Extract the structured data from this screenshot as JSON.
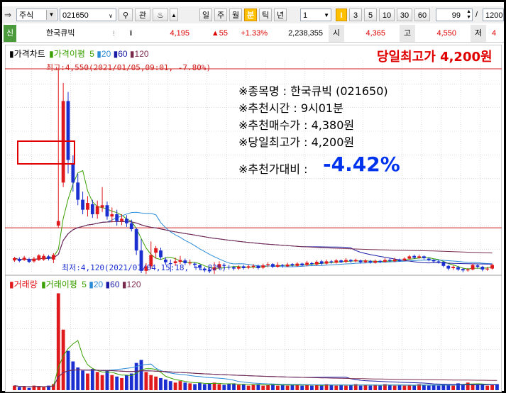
{
  "toolbar": {
    "market": "주식",
    "code": "021650",
    "search_icon": "magnifier-icon",
    "btn_gwan": "관",
    "period_buttons": [
      "일",
      "주",
      "월",
      "분",
      "틱",
      "년"
    ],
    "interval_value": "1",
    "marker_label": "I",
    "minute_buttons": [
      "3",
      "5",
      "10",
      "30",
      "60"
    ],
    "count_value": "99",
    "separator": "/",
    "total_value": "1200"
  },
  "quote": {
    "sin_label": "신",
    "name": "한국큐빅",
    "info_icon": "i",
    "price": "4,195",
    "change": "▲55",
    "change_pct": "+1.33%",
    "volume": "2,238,355",
    "open_label": "시",
    "open": "4,365",
    "high_label": "고",
    "high": "4,550",
    "low_label": "저"
  },
  "legend": {
    "price_chart": "가격차트",
    "ma_label": "가격이평",
    "ma_periods": [
      "5",
      "20",
      "60",
      "120"
    ],
    "volume": "거래량",
    "vol_ma_label": "거래이평",
    "vol_ma_periods": [
      "5",
      "20",
      "60",
      "120"
    ]
  },
  "annotations": {
    "headline": "당일최고가 4,200원",
    "high_note": "최고:4,550(2021/01/05,09:01, -7.80%)",
    "low_note": "최저:4,120(2021/01/04,15:18, +1.82%)",
    "stock_name": "※종목명 : 한국큐빅 (021650)",
    "rec_time": "※추천시간 : 9시01분",
    "rec_price": "※추천매수가 : 4,380원",
    "day_high": "※당일최고가 : 4,200원",
    "vs_label": "※추천가대비 :",
    "vs_value": "-4.42%"
  },
  "colors": {
    "up": "#e0191c",
    "down": "#1b2fd0",
    "ma5": "#3aa000",
    "ma20": "#2c8bd6",
    "ma60": "#1a1aa6",
    "ma120": "#7a2a4c",
    "headline": "#e00000",
    "vs_value": "#0033ee"
  },
  "chart_data": {
    "type": "candlestick",
    "title": "",
    "price_range": [
      4100,
      4570
    ],
    "high_line": 4200,
    "candles": [
      {
        "o": 4128,
        "c": 4133,
        "h": 4136,
        "l": 4125
      },
      {
        "o": 4131,
        "c": 4127,
        "h": 4135,
        "l": 4124
      },
      {
        "o": 4129,
        "c": 4134,
        "h": 4138,
        "l": 4127
      },
      {
        "o": 4131,
        "c": 4125,
        "h": 4134,
        "l": 4122
      },
      {
        "o": 4126,
        "c": 4132,
        "h": 4136,
        "l": 4123
      },
      {
        "o": 4129,
        "c": 4139,
        "h": 4142,
        "l": 4127
      },
      {
        "o": 4130,
        "c": 4138,
        "h": 4142,
        "l": 4127
      },
      {
        "o": 4137,
        "c": 4132,
        "h": 4140,
        "l": 4128
      },
      {
        "o": 4130,
        "c": 4140,
        "h": 4144,
        "l": 4122
      },
      {
        "o": 4205,
        "c": 4215,
        "h": 4550,
        "l": 4200
      },
      {
        "o": 4300,
        "c": 4480,
        "h": 4520,
        "l": 4290
      },
      {
        "o": 4480,
        "c": 4350,
        "h": 4500,
        "l": 4320
      },
      {
        "o": 4340,
        "c": 4300,
        "h": 4360,
        "l": 4280
      },
      {
        "o": 4300,
        "c": 4262,
        "h": 4320,
        "l": 4250
      },
      {
        "o": 4262,
        "c": 4240,
        "h": 4280,
        "l": 4230
      },
      {
        "o": 4240,
        "c": 4255,
        "h": 4270,
        "l": 4225
      },
      {
        "o": 4252,
        "c": 4230,
        "h": 4262,
        "l": 4222
      },
      {
        "o": 4230,
        "c": 4248,
        "h": 4260,
        "l": 4220
      },
      {
        "o": 4245,
        "c": 4250,
        "h": 4290,
        "l": 4235
      },
      {
        "o": 4250,
        "c": 4225,
        "h": 4258,
        "l": 4218
      },
      {
        "o": 4225,
        "c": 4230,
        "h": 4245,
        "l": 4212
      },
      {
        "o": 4230,
        "c": 4215,
        "h": 4240,
        "l": 4205
      },
      {
        "o": 4215,
        "c": 4220,
        "h": 4230,
        "l": 4206
      },
      {
        "o": 4220,
        "c": 4210,
        "h": 4228,
        "l": 4202
      },
      {
        "o": 4210,
        "c": 4197,
        "h": 4218,
        "l": 4192
      },
      {
        "o": 4197,
        "c": 4150,
        "h": 4200,
        "l": 4140
      },
      {
        "o": 4150,
        "c": 4105,
        "h": 4175,
        "l": 4100
      },
      {
        "o": 4105,
        "c": 4115,
        "h": 4122,
        "l": 4098
      },
      {
        "o": 4115,
        "c": 4140,
        "h": 4170,
        "l": 4110
      },
      {
        "o": 4145,
        "c": 4155,
        "h": 4160,
        "l": 4132
      },
      {
        "o": 4150,
        "c": 4135,
        "h": 4156,
        "l": 4130
      },
      {
        "o": 4130,
        "c": 4124,
        "h": 4135,
        "l": 4118
      },
      {
        "o": 4122,
        "c": 4120,
        "h": 4130,
        "l": 4103
      },
      {
        "o": 4122,
        "c": 4126,
        "h": 4134,
        "l": 4116
      },
      {
        "o": 4125,
        "c": 4129,
        "h": 4138,
        "l": 4120
      },
      {
        "o": 4128,
        "c": 4122,
        "h": 4132,
        "l": 4118
      },
      {
        "o": 4122,
        "c": 4123,
        "h": 4130,
        "l": 4117
      },
      {
        "o": 4121,
        "c": 4118,
        "h": 4124,
        "l": 4113
      },
      {
        "o": 4117,
        "c": 4112,
        "h": 4119,
        "l": 4108
      },
      {
        "o": 4110,
        "c": 4106,
        "h": 4114,
        "l": 4102
      },
      {
        "o": 4107,
        "c": 4104,
        "h": 4112,
        "l": 4100
      },
      {
        "o": 4106,
        "c": 4113,
        "h": 4124,
        "l": 4098
      },
      {
        "o": 4112,
        "c": 4120,
        "h": 4126,
        "l": 4108
      },
      {
        "o": 4118,
        "c": 4116,
        "h": 4122,
        "l": 4110
      },
      {
        "o": 4114,
        "c": 4113,
        "h": 4118,
        "l": 4108
      },
      {
        "o": 4113,
        "c": 4110,
        "h": 4116,
        "l": 4106
      },
      {
        "o": 4110,
        "c": 4114,
        "h": 4117,
        "l": 4107
      },
      {
        "o": 4115,
        "c": 4111,
        "h": 4118,
        "l": 4108
      },
      {
        "o": 4112,
        "c": 4115,
        "h": 4119,
        "l": 4109
      },
      {
        "o": 4114,
        "c": 4116,
        "h": 4120,
        "l": 4110
      },
      {
        "o": 4116,
        "c": 4111,
        "h": 4119,
        "l": 4108
      },
      {
        "o": 4112,
        "c": 4117,
        "h": 4121,
        "l": 4109
      },
      {
        "o": 4118,
        "c": 4120,
        "h": 4124,
        "l": 4113
      },
      {
        "o": 4120,
        "c": 4114,
        "h": 4122,
        "l": 4111
      },
      {
        "o": 4114,
        "c": 4118,
        "h": 4124,
        "l": 4112
      },
      {
        "o": 4118,
        "c": 4116,
        "h": 4120,
        "l": 4112
      },
      {
        "o": 4115,
        "c": 4119,
        "h": 4123,
        "l": 4113
      },
      {
        "o": 4120,
        "c": 4117,
        "h": 4122,
        "l": 4114
      },
      {
        "o": 4116,
        "c": 4121,
        "h": 4124,
        "l": 4114
      },
      {
        "o": 4121,
        "c": 4117,
        "h": 4123,
        "l": 4115
      },
      {
        "o": 4118,
        "c": 4123,
        "h": 4127,
        "l": 4115
      },
      {
        "o": 4122,
        "c": 4120,
        "h": 4125,
        "l": 4117
      },
      {
        "o": 4119,
        "c": 4125,
        "h": 4128,
        "l": 4117
      },
      {
        "o": 4126,
        "c": 4121,
        "h": 4129,
        "l": 4118
      },
      {
        "o": 4121,
        "c": 4126,
        "h": 4130,
        "l": 4119
      },
      {
        "o": 4126,
        "c": 4124,
        "h": 4129,
        "l": 4121
      },
      {
        "o": 4123,
        "c": 4128,
        "h": 4131,
        "l": 4121
      },
      {
        "o": 4128,
        "c": 4124,
        "h": 4130,
        "l": 4122
      },
      {
        "o": 4125,
        "c": 4129,
        "h": 4133,
        "l": 4122
      },
      {
        "o": 4129,
        "c": 4126,
        "h": 4131,
        "l": 4123
      },
      {
        "o": 4126,
        "c": 4129,
        "h": 4132,
        "l": 4124
      },
      {
        "o": 4128,
        "c": 4124,
        "h": 4130,
        "l": 4121
      },
      {
        "o": 4124,
        "c": 4128,
        "h": 4131,
        "l": 4122
      },
      {
        "o": 4127,
        "c": 4124,
        "h": 4129,
        "l": 4121
      },
      {
        "o": 4123,
        "c": 4127,
        "h": 4130,
        "l": 4121
      },
      {
        "o": 4127,
        "c": 4125,
        "h": 4129,
        "l": 4122
      },
      {
        "o": 4125,
        "c": 4129,
        "h": 4133,
        "l": 4123
      },
      {
        "o": 4129,
        "c": 4127,
        "h": 4132,
        "l": 4124
      },
      {
        "o": 4126,
        "c": 4130,
        "h": 4134,
        "l": 4124
      },
      {
        "o": 4130,
        "c": 4127,
        "h": 4132,
        "l": 4125
      },
      {
        "o": 4128,
        "c": 4132,
        "h": 4135,
        "l": 4126
      },
      {
        "o": 4132,
        "c": 4137,
        "h": 4140,
        "l": 4130
      },
      {
        "o": 4138,
        "c": 4134,
        "h": 4141,
        "l": 4131
      },
      {
        "o": 4134,
        "c": 4137,
        "h": 4141,
        "l": 4132
      },
      {
        "o": 4137,
        "c": 4133,
        "h": 4139,
        "l": 4130
      },
      {
        "o": 4132,
        "c": 4129,
        "h": 4135,
        "l": 4126
      },
      {
        "o": 4129,
        "c": 4126,
        "h": 4131,
        "l": 4122
      },
      {
        "o": 4126,
        "c": 4125,
        "h": 4129,
        "l": 4121
      },
      {
        "o": 4125,
        "c": 4116,
        "h": 4126,
        "l": 4113
      },
      {
        "o": 4116,
        "c": 4110,
        "h": 4118,
        "l": 4106
      },
      {
        "o": 4111,
        "c": 4114,
        "h": 4117,
        "l": 4107
      },
      {
        "o": 4113,
        "c": 4108,
        "h": 4116,
        "l": 4105
      },
      {
        "o": 4109,
        "c": 4106,
        "h": 4112,
        "l": 4102
      },
      {
        "o": 4106,
        "c": 4108,
        "h": 4111,
        "l": 4103
      },
      {
        "o": 4108,
        "c": 4118,
        "h": 4121,
        "l": 4106
      },
      {
        "o": 4117,
        "c": 4114,
        "h": 4120,
        "l": 4110
      },
      {
        "o": 4114,
        "c": 4108,
        "h": 4116,
        "l": 4104
      },
      {
        "o": 4108,
        "c": 4110,
        "h": 4114,
        "l": 4105
      },
      {
        "o": 4110,
        "c": 4118,
        "h": 4121,
        "l": 4108
      }
    ],
    "volumes": [
      6,
      4,
      5,
      3,
      6,
      5,
      4,
      6,
      8,
      128,
      80,
      52,
      38,
      30,
      26,
      22,
      28,
      24,
      20,
      26,
      20,
      18,
      16,
      20,
      22,
      36,
      40,
      24,
      20,
      18,
      16,
      14,
      12,
      10,
      12,
      10,
      9,
      8,
      10,
      8,
      9,
      10,
      8,
      7,
      8,
      9,
      7,
      8,
      6,
      7,
      8,
      6,
      7,
      8,
      6,
      7,
      6,
      7,
      8,
      6,
      7,
      6,
      7,
      6,
      8,
      7,
      6,
      7,
      6,
      7,
      8,
      6,
      7,
      6,
      7,
      6,
      8,
      7,
      6,
      7,
      6,
      7,
      6,
      8,
      7,
      6,
      7,
      6,
      8,
      7,
      6,
      9,
      8,
      10,
      8,
      7,
      8,
      6,
      7,
      8
    ]
  }
}
